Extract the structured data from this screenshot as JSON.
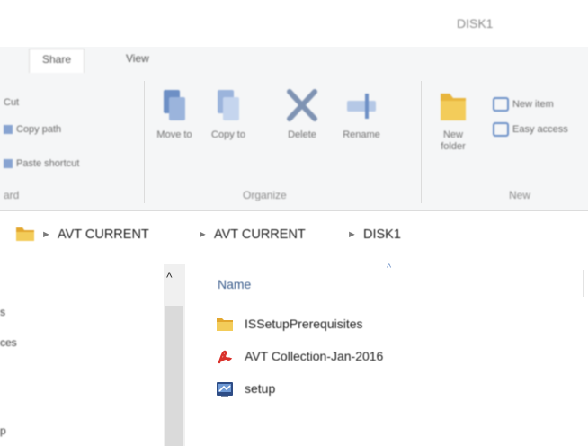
{
  "window": {
    "title": "DISK1"
  },
  "ribbon": {
    "tabs": [
      {
        "label": "Share"
      },
      {
        "label": "View"
      }
    ],
    "clipboard": {
      "items": [
        "Cut",
        "Copy path",
        "Paste shortcut"
      ],
      "group_label": "ard"
    },
    "organize": {
      "buttons": [
        {
          "label": "Move to"
        },
        {
          "label": "Copy to"
        },
        {
          "label": "Delete"
        },
        {
          "label": "Rename"
        }
      ],
      "group_label": "Organize"
    },
    "new": {
      "folder_label": "New folder",
      "items": [
        "New item",
        "Easy access"
      ],
      "group_label": "New"
    }
  },
  "address": {
    "crumbs": [
      "AVT CURRENT",
      "AVT CURRENT",
      "DISK1"
    ]
  },
  "navpane": {
    "partial_items": [
      "s",
      "ces",
      "p"
    ]
  },
  "filelist": {
    "column_name": "Name",
    "files": [
      {
        "name": "ISSetupPrerequisites",
        "icon": "folder-icon"
      },
      {
        "name": "AVT Collection-Jan-2016",
        "icon": "pdf-icon"
      },
      {
        "name": "setup",
        "icon": "setup-exe-icon"
      }
    ]
  },
  "colors": {
    "folder": "#e8b53c",
    "pdf": "#d9312b",
    "accent": "#3b5d8c",
    "ribbon_bg": "#f5f6f7"
  }
}
